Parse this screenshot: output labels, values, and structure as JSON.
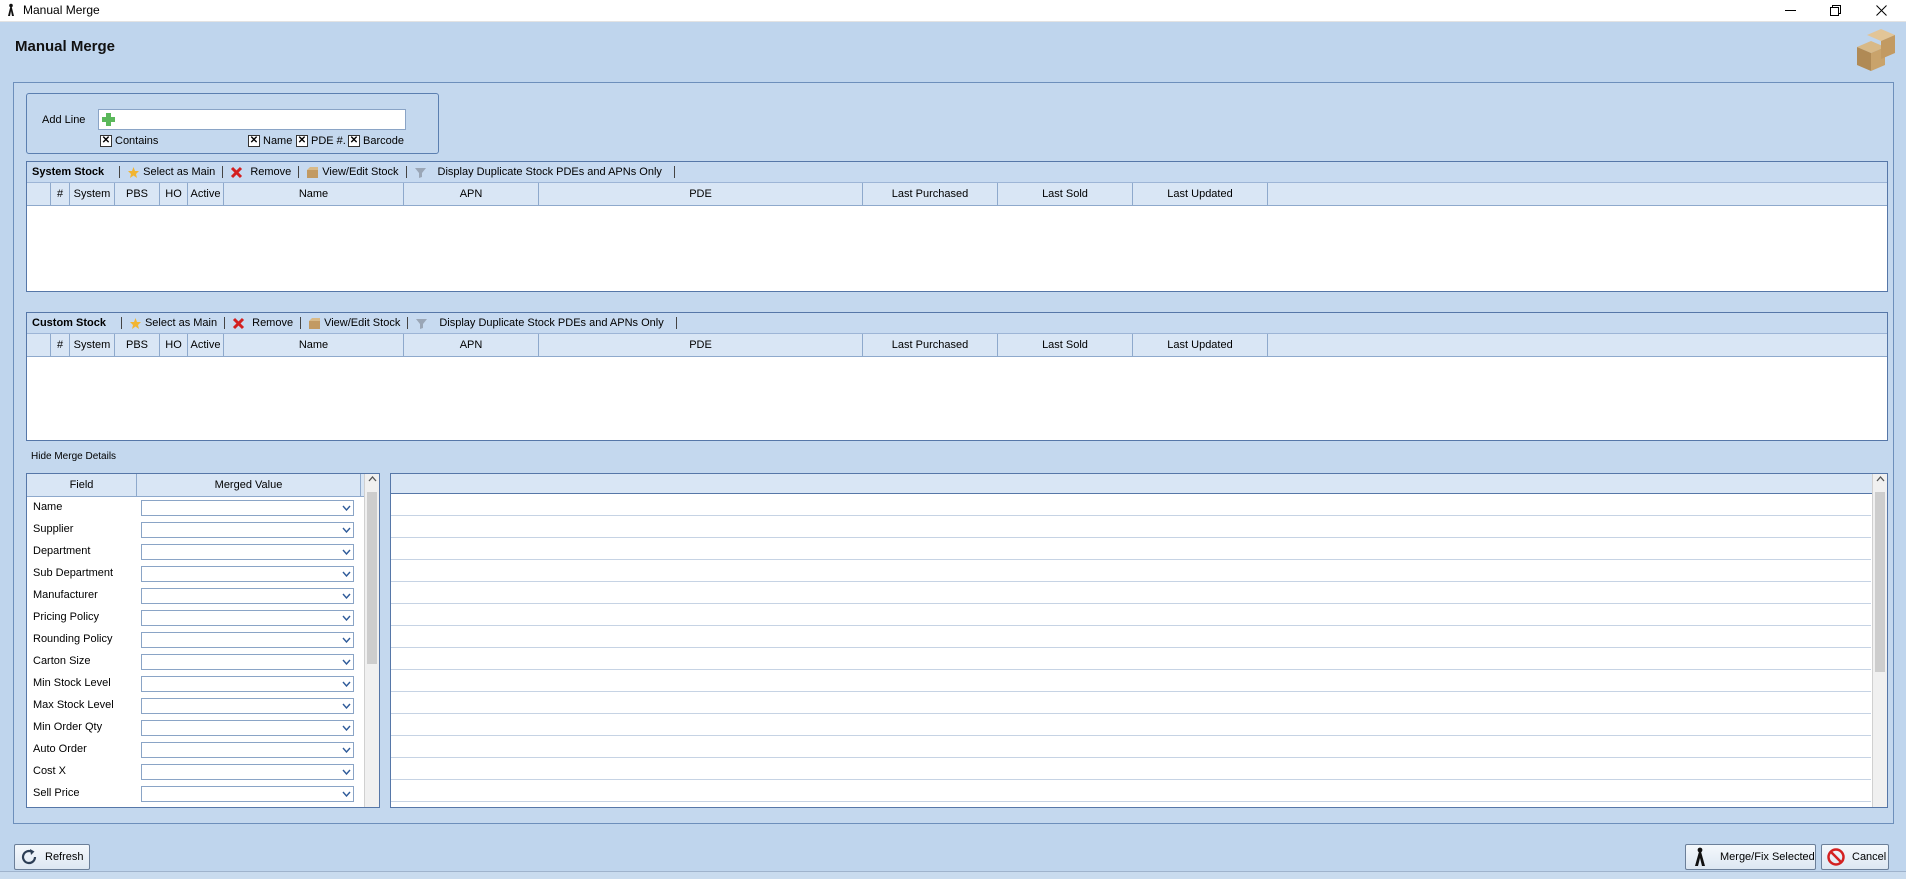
{
  "window": {
    "title": "Manual Merge",
    "minimize_icon": "minimize-icon",
    "restore_icon": "restore-icon",
    "close_icon": "close-icon"
  },
  "page": {
    "title": "Manual Merge",
    "header_icon": "boxes-icon"
  },
  "add_line": {
    "label": "Add Line",
    "value": "",
    "icon": "plus-icon",
    "checkboxes": [
      {
        "label": "Contains",
        "checked": true
      },
      {
        "label": "Name",
        "checked": true
      },
      {
        "label": "PDE #.",
        "checked": true
      },
      {
        "label": "Barcode",
        "checked": true
      }
    ]
  },
  "system_stock": {
    "title": "System Stock",
    "toolbar": {
      "select_main": "Select as Main",
      "remove": "Remove",
      "view_edit": "View/Edit Stock",
      "display_duplicates": "Display Duplicate Stock PDEs and APNs Only"
    },
    "columns": [
      "",
      "#",
      "System",
      "PBS",
      "HO",
      "Active",
      "Name",
      "APN",
      "PDE",
      "Last Purchased",
      "Last Sold",
      "Last Updated"
    ]
  },
  "custom_stock": {
    "title": "Custom Stock",
    "toolbar": {
      "select_main": "Select as Main",
      "remove": "Remove",
      "view_edit": "View/Edit Stock",
      "display_duplicates": "Display Duplicate Stock PDEs and APNs Only"
    },
    "columns": [
      "",
      "#",
      "System",
      "PBS",
      "HO",
      "Active",
      "Name",
      "APN",
      "PDE",
      "Last Purchased",
      "Last Sold",
      "Last Updated"
    ]
  },
  "merge_details": {
    "toggle_label": "Hide Merge Details",
    "columns": {
      "field": "Field",
      "merged_value": "Merged Value"
    },
    "fields": [
      "Name",
      "Supplier",
      "Department",
      "Sub Department",
      "Manufacturer",
      "Pricing Policy",
      "Rounding Policy",
      "Carton Size",
      "Min Stock Level",
      "Max Stock Level",
      "Min Order Qty",
      "Auto Order",
      "Cost X",
      "Sell Price"
    ]
  },
  "footer": {
    "refresh": "Refresh",
    "merge_fix": "Merge/Fix Selected",
    "cancel": "Cancel"
  },
  "colors": {
    "background": "#bfd5ed",
    "grid_border": "#5677a8",
    "header_fill": "#d9e6f5"
  }
}
